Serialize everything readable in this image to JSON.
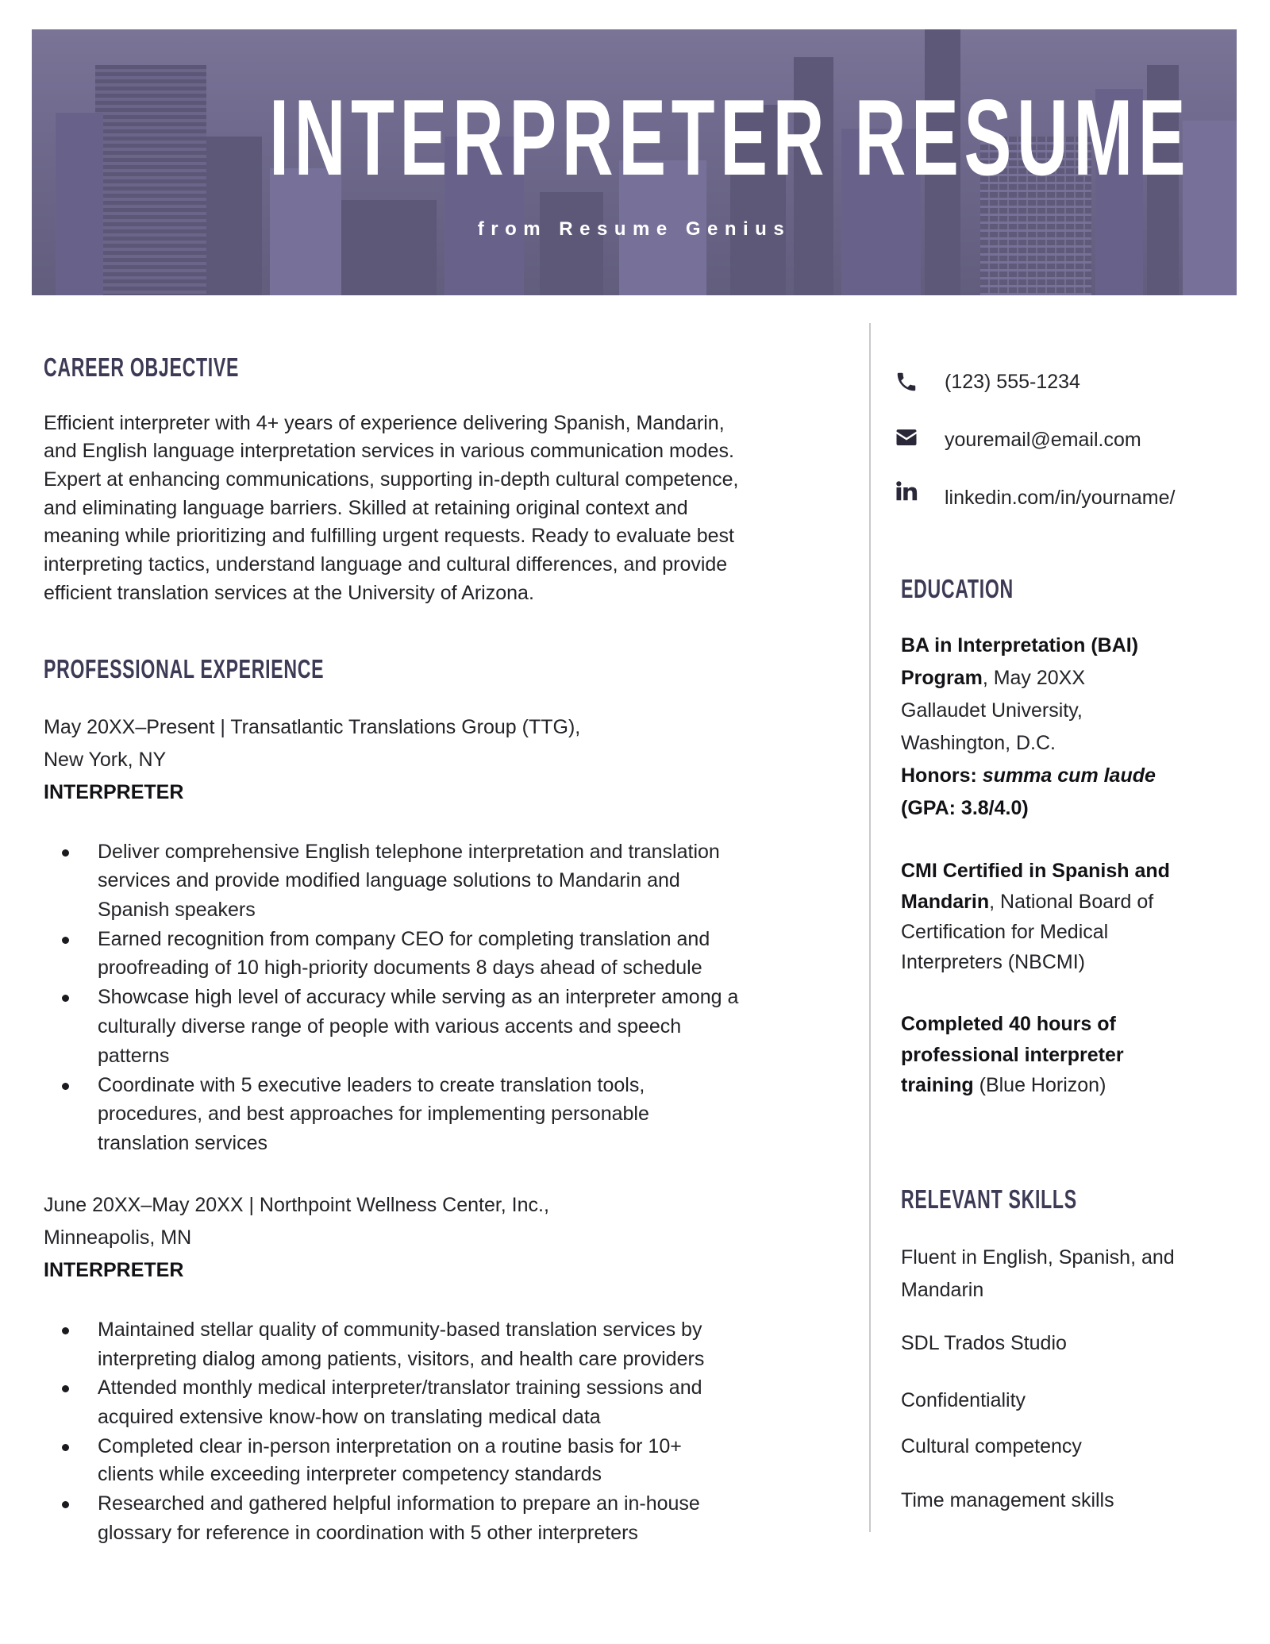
{
  "banner": {
    "title": "INTERPRETER RESUME",
    "subtitle": "from Resume Genius",
    "background_color": "#6c6688"
  },
  "career_objective": {
    "heading": "CAREER OBJECTIVE",
    "lines": [
      "Efficient interpreter with 4+ years of experience delivering Spanish, Mandarin,",
      "and English language interpretation services in various communication modes.",
      "Expert at enhancing communications, supporting in-depth cultural competence,",
      "and eliminating language barriers. Skilled at retaining original context and",
      "meaning while prioritizing and fulfilling urgent requests. Ready to evaluate best",
      "interpreting tactics, understand language and cultural differences, and provide",
      "efficient translation services at the University of Arizona."
    ]
  },
  "experience": {
    "heading": "PROFESSIONAL EXPERIENCE",
    "jobs": [
      {
        "header_line1": "May 20XX–Present | Transatlantic Translations Group (TTG),",
        "header_line2": "New York, NY",
        "title": "INTERPRETER",
        "bullets": [
          [
            "Deliver comprehensive English telephone interpretation and translation",
            "services and provide modified language solutions to Mandarin and",
            "Spanish speakers"
          ],
          [
            "Earned recognition from company CEO for completing translation and",
            "proofreading of 10 high-priority documents 8 days ahead of schedule"
          ],
          [
            "Showcase high level of accuracy while serving as an interpreter among a",
            "culturally diverse range of people with various accents and speech",
            "patterns"
          ],
          [
            "Coordinate with 5 executive leaders to create translation tools,",
            "procedures, and best approaches for implementing personable",
            "translation services"
          ]
        ]
      },
      {
        "header_line1": "June 20XX–May 20XX | Northpoint Wellness Center, Inc.,",
        "header_line2": "Minneapolis, MN",
        "title": "INTERPRETER",
        "bullets": [
          [
            "Maintained stellar quality of community-based translation services by",
            "interpreting dialog among patients, visitors, and health care providers"
          ],
          [
            "Attended monthly medical interpreter/translator training sessions and",
            "acquired extensive know-how on translating medical data"
          ],
          [
            "Completed clear in-person interpretation on a routine basis for 10+",
            "clients while exceeding interpreter competency standards"
          ],
          [
            "Researched and gathered helpful information to prepare an in-house",
            "glossary for reference in coordination with 5 other interpreters"
          ]
        ]
      }
    ]
  },
  "contact": {
    "phone": {
      "icon": "phone-icon",
      "text": "(123) 555-1234"
    },
    "email": {
      "icon": "envelope-icon",
      "text": "youremail@email.com"
    },
    "linkedin": {
      "icon": "linkedin-icon",
      "text": "linkedin.com/in/yourname/"
    }
  },
  "education": {
    "heading": "EDUCATION",
    "degree": {
      "name_line1": "BA in Interpretation (BAI)",
      "name_line2": "Program",
      "date": ", May 20XX",
      "school_line1": "Gallaudet University,",
      "school_line2": "Washington, D.C.",
      "honors_label": "Honors: ",
      "honors_value": "summa cum laude",
      "gpa": "(GPA: 3.8/4.0)"
    },
    "certification": {
      "name_line1": "CMI Certified in Spanish and",
      "name_line2": "Mandarin",
      "issuer_line1": ", National Board of",
      "issuer_line2": "Certification for Medical",
      "issuer_line3": "Interpreters (NBCMI)"
    },
    "training": {
      "line1": "Completed 40 hours of",
      "line2": "professional interpreter",
      "line3": "training",
      "provider": " (Blue Horizon)"
    }
  },
  "skills": {
    "heading": "RELEVANT SKILLS",
    "items": [
      [
        "Fluent in English, Spanish, and",
        "Mandarin"
      ],
      [
        "SDL Trados Studio"
      ],
      [
        "Confidentiality"
      ],
      [
        "Cultural competency"
      ],
      [
        "Time management skills"
      ]
    ]
  },
  "colors": {
    "heading": "#3d3a55",
    "text": "#232328",
    "divider": "#c9c9cc",
    "icon": "#2a2838"
  }
}
